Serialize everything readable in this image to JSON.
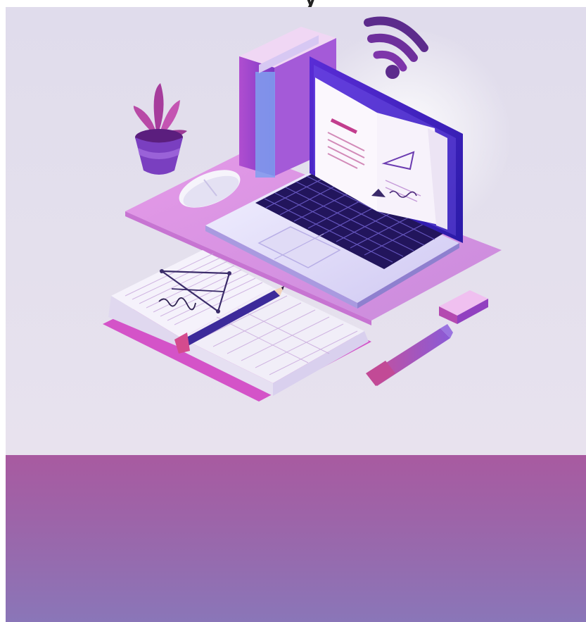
{
  "page": {
    "cut_title": "y",
    "colors": {
      "hero_bg": "#e2deec",
      "band_top": "#a85aa0",
      "band_bottom": "#8a76b8",
      "accent_purple": "#7a2fa0",
      "accent_pink": "#d26bd6",
      "keyboard": "#2a1b66"
    }
  },
  "illustration": {
    "icons": [
      "wifi-icon",
      "books-icon",
      "plant-icon",
      "mouse-icon",
      "laptop-icon",
      "notebook-icon",
      "pencil-icon",
      "eraser-icon",
      "marker-icon"
    ]
  }
}
